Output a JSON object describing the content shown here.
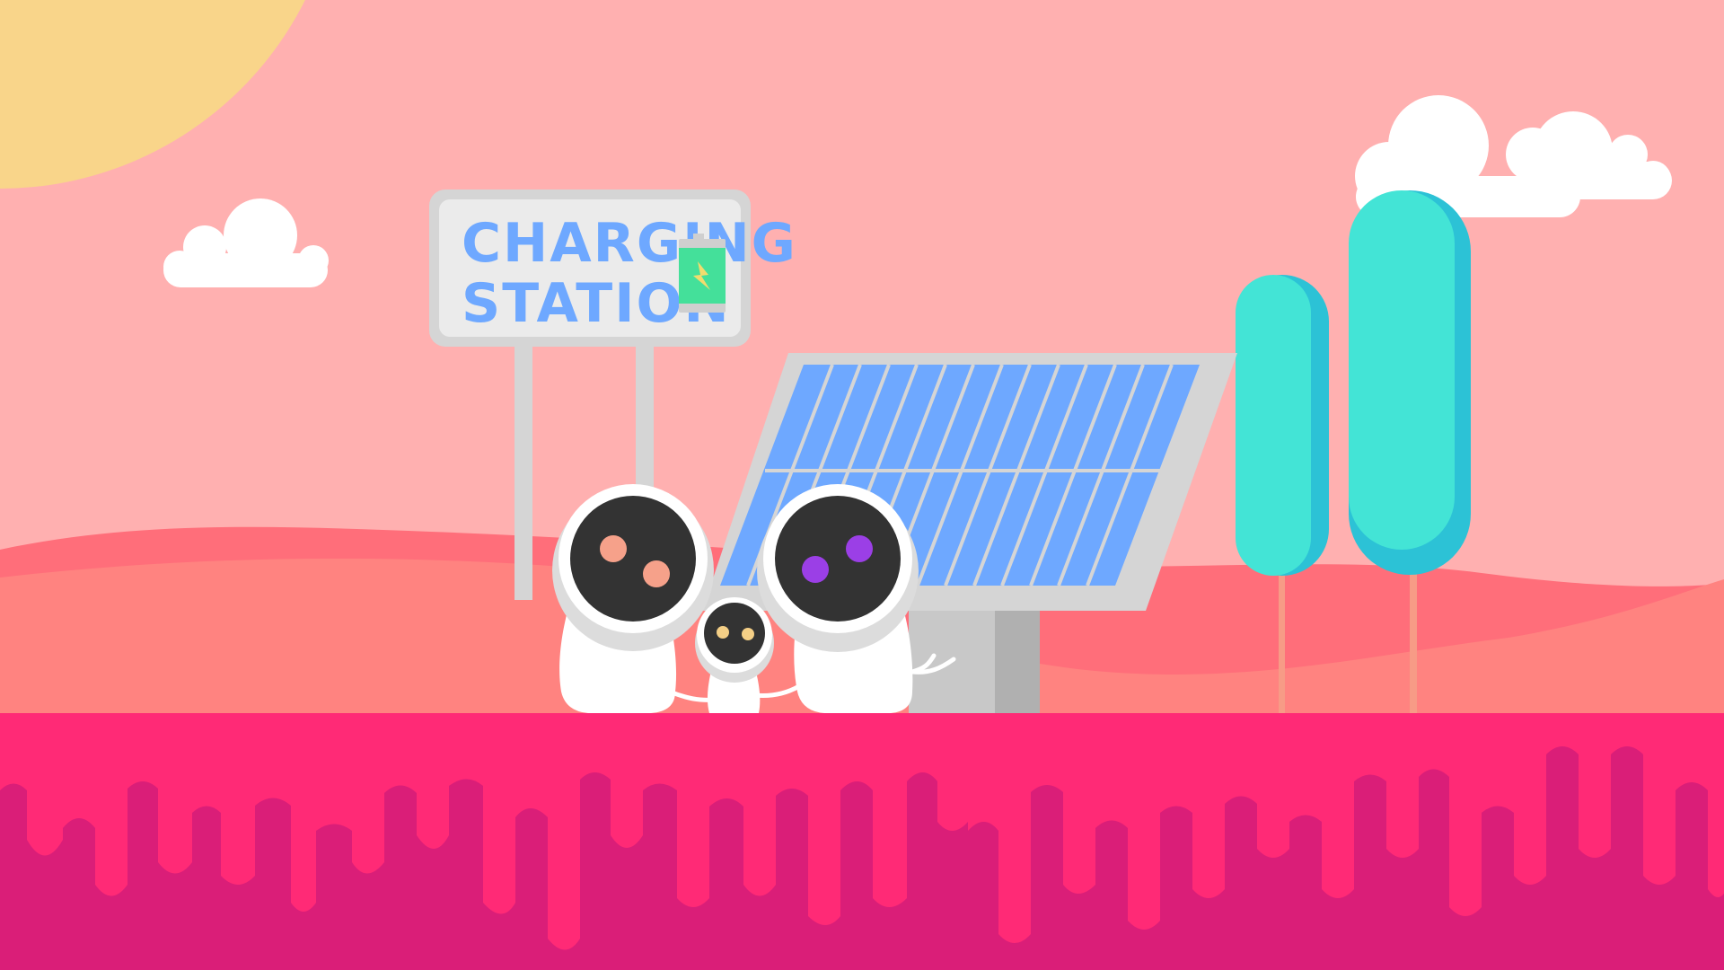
{
  "scene": {
    "sign": {
      "line1": "CHARGING",
      "line2": "STATION"
    },
    "icons": {
      "battery": "battery-charging-icon",
      "solar_panel": "solar-panel",
      "sun": "sun"
    },
    "characters": [
      {
        "name": "robot-left",
        "eye_color": "#F6A18A"
      },
      {
        "name": "robot-small",
        "eye_color": "#F4CF86"
      },
      {
        "name": "robot-right",
        "eye_color": "#9B3FE6"
      }
    ],
    "colors": {
      "sky": "#FFB0B0",
      "sun": "#F9D58A",
      "hill_back": "#FF6E7A",
      "hill_front": "#FF8380",
      "ground": "#FF2A76",
      "ground_drips": "#DA1E78",
      "solar_cell": "#6EA8FF",
      "tree": "#43E4D6",
      "tree_shade": "#2CC2D6",
      "battery": "#44E09A"
    }
  }
}
